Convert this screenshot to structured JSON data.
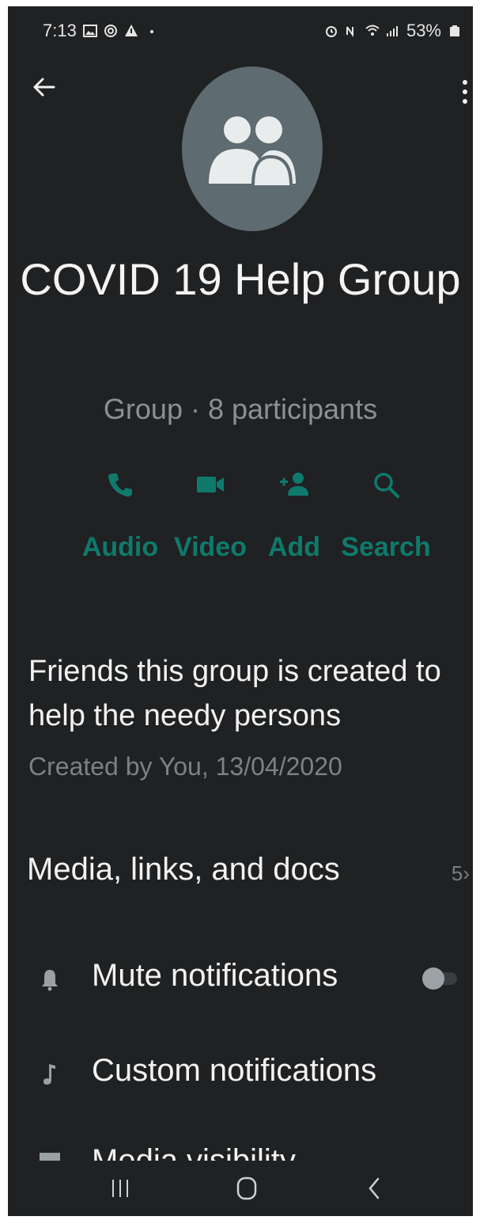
{
  "status_bar": {
    "time": "7:13",
    "battery": "53%"
  },
  "group": {
    "title": "COVID 19 Help Group",
    "subtitle": "Group · 8 participants"
  },
  "actions": [
    {
      "label": "Audio",
      "icon": "phone-icon"
    },
    {
      "label": "Video",
      "icon": "video-icon"
    },
    {
      "label": "Add",
      "icon": "add-person-icon"
    },
    {
      "label": "Search",
      "icon": "search-icon"
    }
  ],
  "description": {
    "text": "Friends this group is created to help the needy persons",
    "created": "Created by You, 13/04/2020"
  },
  "media": {
    "label": "Media, links, and docs",
    "count": "5"
  },
  "settings": {
    "mute_label": "Mute notifications",
    "mute_enabled": false,
    "custom_label": "Custom notifications",
    "visibility_label": "Media visibility"
  },
  "colors": {
    "background": "#1f2123",
    "accent": "#0f7a6b",
    "avatar": "#5e6b71",
    "secondary_text": "#8d8f91"
  }
}
